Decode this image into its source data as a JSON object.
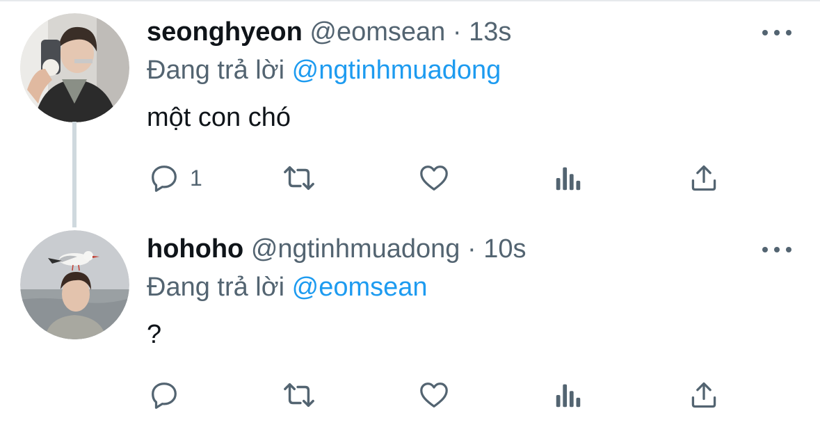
{
  "tweets": [
    {
      "name": "seonghyeon",
      "handle": "@eomsean",
      "separator": "·",
      "time": "13s",
      "reply_prefix": "Đang trả lời",
      "reply_to": "@ngtinhmuadong",
      "text": "một con chó",
      "reply_count": "1",
      "avatar": "person-with-phone-photo"
    },
    {
      "name": "hohoho",
      "handle": "@ngtinhmuadong",
      "separator": "·",
      "time": "10s",
      "reply_prefix": "Đang trả lời",
      "reply_to": "@eomsean",
      "text": "?",
      "reply_count": "",
      "avatar": "seagull-on-head-photo"
    }
  ],
  "icons": [
    "reply-icon",
    "retweet-icon",
    "like-icon",
    "views-icon",
    "share-icon",
    "more-icon"
  ],
  "colors": {
    "link": "#1d9bf0",
    "secondary": "#536471",
    "text": "#0f1419",
    "thread_line": "#cfd9de"
  }
}
